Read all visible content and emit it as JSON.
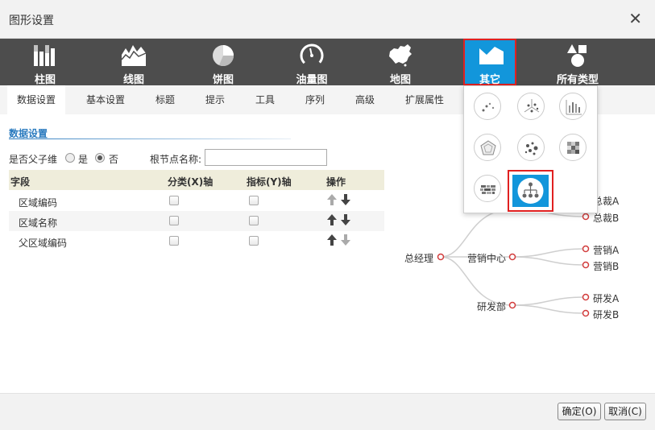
{
  "dialog": {
    "title": "图形设置",
    "close_symbol": "✕"
  },
  "chart_types": [
    {
      "label": "柱图"
    },
    {
      "label": "线图"
    },
    {
      "label": "饼图"
    },
    {
      "label": "油量图"
    },
    {
      "label": "地图"
    },
    {
      "label": "其它"
    },
    {
      "label": "所有类型"
    }
  ],
  "tabs": [
    {
      "label": "数据设置"
    },
    {
      "label": "基本设置"
    },
    {
      "label": "标题"
    },
    {
      "label": "提示"
    },
    {
      "label": "工具"
    },
    {
      "label": "序列"
    },
    {
      "label": "高级"
    },
    {
      "label": "扩展属性"
    }
  ],
  "data_settings": {
    "section_title": "数据设置",
    "parent_child_label": "是否父子维",
    "yes_label": "是",
    "no_label": "否",
    "selected": "否",
    "root_label": "根节点名称:",
    "root_value": ""
  },
  "field_table": {
    "headers": [
      "字段",
      "分类(X)轴",
      "指标(Y)轴",
      "操作"
    ],
    "rows": [
      {
        "name": "区域编码",
        "x_axis": false,
        "y_axis": false
      },
      {
        "name": "区域名称",
        "x_axis": false,
        "y_axis": false
      },
      {
        "name": "父区域编码",
        "x_axis": false,
        "y_axis": false
      }
    ]
  },
  "tree_preview": {
    "root": "总经理",
    "nodes": [
      "营销中心",
      "研发部"
    ],
    "leaves": [
      "总裁A",
      "总裁B",
      "营销A",
      "营销B",
      "研发A",
      "研发B"
    ]
  },
  "footer": {
    "ok_label": "确定(O)",
    "cancel_label": "取消(C)"
  },
  "colors": {
    "accent": "#1296db",
    "highlight": "#e02020",
    "typebar": "#4d4d4d",
    "node": "#d23c3c"
  }
}
